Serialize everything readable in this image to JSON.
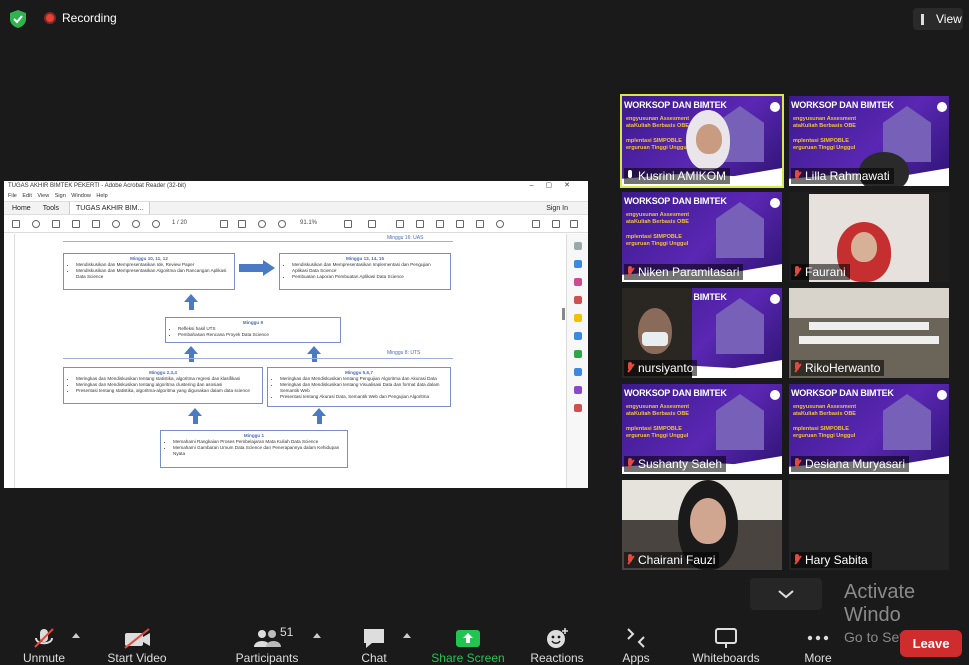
{
  "topbar": {
    "recording_label": "Recording",
    "view_label": "View"
  },
  "share": {
    "window_title": "TUGAS AKHIR BIMTEK PEKERTI - Adobe Acrobat Reader (32-bit)",
    "menu": "File  Edit  View  Sign  Window  Help",
    "tabs": {
      "home": "Home",
      "tools": "Tools",
      "doc": "TUGAS AKHIR BIM...",
      "sign_in": "Sign In"
    },
    "toolbar": {
      "page_current": "1",
      "page_total": "/ 20",
      "zoom": "91.1%"
    },
    "doc": {
      "label_uas": "Minggu 16: UAS",
      "label_uts": "Minggu 8:  UTS",
      "box_top_left": {
        "head": "Minggu 10, 11, 12",
        "items": [
          "Mendiskusikan dan Mempresentasikan Ide, Review Paper",
          "Mendiskusikan dan Mempresentasikan Algoritma dan Rancangan Aplikasi Data Science"
        ]
      },
      "box_top_right": {
        "head": "Minggu 13, 14, 15",
        "items": [
          "Mendiskusikan dan Mempresentasikan Implementasi dan Pengujian Aplikasi Data Science",
          "Pembuatan Laporan Pembuatan Aplikasi Data Science"
        ]
      },
      "box_mid": {
        "head": "Minggu 9",
        "items": [
          "Refleksi hasil UTS",
          "Pembahasan Rencana Proyek Data Science"
        ]
      },
      "box_low_left": {
        "head": "Minggu 2,3,4",
        "items": [
          "Meringkas dan Mendiskusikan tentang statistika, algoritma regresi dan klasifikasi",
          "Meringkas dan Mendiskusikan tentang algoritma clustering dan asosiasi",
          "Presentasi tentang statistika, algoritma-algoritma yang digunakan dalam data science"
        ]
      },
      "box_low_right": {
        "head": "Minggu 5,6,7",
        "items": [
          "Meringkas dan Mendiskusikan tentang Pengujian Algoritma dan Akurasi Data",
          "Meringkas dan Mendiskusikan tentang Visualisasi Data dan format data dalam Semantik Web",
          "Presentasi tentang Akurasi Data, Semantik Web dan Pengujian Algoritma"
        ]
      },
      "box_bottom": {
        "head": "Minggu 1",
        "items": [
          "Memahami Rangkaian Proses Pembelajaran Mata Kuliah Data Science",
          "Memahami Gambaran Umum Data Science dan Penerapannya dalam Kehidupan Nyata"
        ]
      }
    }
  },
  "slide": {
    "title": "WORKSOP DAN BIMTEK",
    "line1": "engyusunan Assesment",
    "line2": "ataKuliah Berbasis OBE",
    "line3": "mplentasi SIMPOBLE",
    "line4": "erguruan Tinggi Unggul"
  },
  "participants": [
    {
      "name": "Kusrini AMIKOM",
      "muted": false
    },
    {
      "name": "Lilla Rahmawati",
      "muted": true
    },
    {
      "name": "Niken Paramitasari",
      "muted": true
    },
    {
      "name": "Faurani",
      "muted": true
    },
    {
      "name": "nursiyanto",
      "muted": true
    },
    {
      "name": "RikoHerwanto",
      "muted": true
    },
    {
      "name": "Sushanty Saleh",
      "muted": true
    },
    {
      "name": "Desiana Muryasari",
      "muted": true
    },
    {
      "name": "Chairani Fauzi",
      "muted": true
    },
    {
      "name": "Hary Sabita",
      "muted": true
    }
  ],
  "watermark": {
    "line1": "Activate Windo",
    "line2": "Go to Settings to a"
  },
  "controls": {
    "unmute": "Unmute",
    "start_video": "Start Video",
    "participants": "Participants",
    "participants_count": "51",
    "chat": "Chat",
    "share_screen": "Share Screen",
    "reactions": "Reactions",
    "apps": "Apps",
    "whiteboards": "Whiteboards",
    "more": "More",
    "leave": "Leave"
  },
  "colors": {
    "accent_green": "#23c552",
    "leave_red": "#cf2d2d",
    "active_speaker": "#d6e84c",
    "slide_purple": "#5a27b3"
  }
}
